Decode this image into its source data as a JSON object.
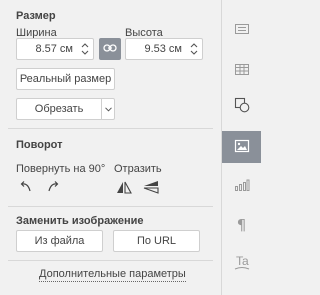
{
  "size": {
    "title": "Размер",
    "width_label": "Ширина",
    "height_label": "Высота",
    "width_value": "8.57 см",
    "height_value": "9.53 см",
    "actual_size_button": "Реальный размер",
    "crop_button": "Обрезать"
  },
  "rotation": {
    "title": "Поворот",
    "rotate_label": "Повернуть на 90°",
    "flip_label": "Отразить"
  },
  "replace": {
    "title": "Заменить изображение",
    "from_file_button": "Из файла",
    "from_url_button": "По URL"
  },
  "advanced_link": "Дополнительные параметры",
  "sidebar": {
    "items": [
      "paragraph-settings-icon",
      "table-settings-icon",
      "shape-settings-icon",
      "image-settings-icon",
      "chart-settings-icon",
      "pilcrow-icon",
      "text-art-icon"
    ],
    "active_color": "#8a9099"
  }
}
